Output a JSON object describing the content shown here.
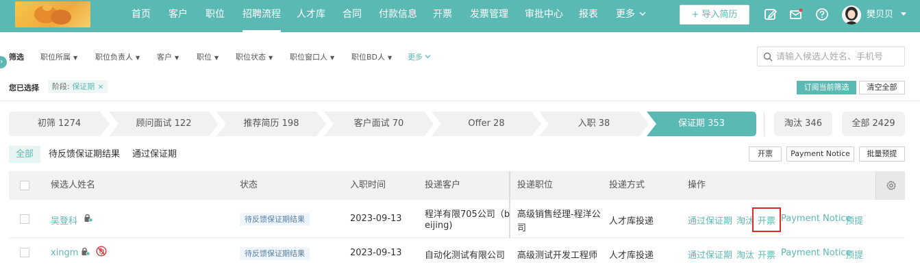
{
  "nav": {
    "items": [
      "首页",
      "客户",
      "职位",
      "招聘流程",
      "人才库",
      "合同",
      "付款信息",
      "开票",
      "发票管理",
      "审批中心",
      "报表",
      "更多"
    ],
    "active_index": 3,
    "import_button": "+ 导入简历",
    "username": "樊贝贝"
  },
  "filters": {
    "title": "筛选",
    "items": [
      "职位所属",
      "职位负责人",
      "客户",
      "职位",
      "职位状态",
      "职位窗口人",
      "职位BD人"
    ],
    "more": "更多",
    "search_placeholder": "请输入候选人姓名、手机号"
  },
  "selected": {
    "title": "您已选择",
    "chip_label": "阶段: ",
    "chip_value": "保证期",
    "chip_close": "×",
    "subscribe": "订阅当前筛选",
    "clear_all": "清空全部"
  },
  "stages": [
    {
      "label": "初筛 1274"
    },
    {
      "label": "顾问面试 122"
    },
    {
      "label": "推荐简历 198"
    },
    {
      "label": "客户面试 70"
    },
    {
      "label": "Offer 28"
    },
    {
      "label": "入职 38"
    },
    {
      "label": "保证期 353"
    }
  ],
  "stage_boxes": [
    "淘汰 346",
    "全部 2429"
  ],
  "subtabs": [
    "全部",
    "待反馈保证期结果",
    "通过保证期"
  ],
  "actions": [
    "开票",
    "Payment Notice",
    "批量预提"
  ],
  "table": {
    "headers": [
      "候选人姓名",
      "状态",
      "入职时间",
      "投递客户",
      "投递职位",
      "投递方式",
      "操作"
    ],
    "rows": [
      {
        "name": "吴登科",
        "status": "待反馈保证期结果",
        "date": "2023-09-13",
        "client_line1": "程洋有限705公司（b",
        "client_line2": "eijing)",
        "position_line1": "高级销售经理-程洋公",
        "position_line2": "司",
        "method": "人才库投递",
        "ops": [
          "通过保证期",
          "淘汰",
          "开票",
          "Payment Notice",
          "预提"
        ]
      },
      {
        "name": "xingm",
        "status": "待反馈保证期结果",
        "date": "2023-09-13",
        "client_line1": "自动化测试有限公司",
        "position_line1": "高级测试开发工程师",
        "method": "人才库投递",
        "ops": [
          "通过保证期",
          "淘汰",
          "开票",
          "Payment Notice",
          "预提"
        ]
      }
    ]
  },
  "colors": {
    "accent": "#5bb9b3",
    "highlight_box": "#e3262a",
    "status_badge_bg": "#eef6fb"
  },
  "icons": [
    "edit-icon",
    "mail-icon",
    "help-icon",
    "search-icon",
    "gear-icon",
    "lock-icon",
    "no-touch-icon"
  ]
}
